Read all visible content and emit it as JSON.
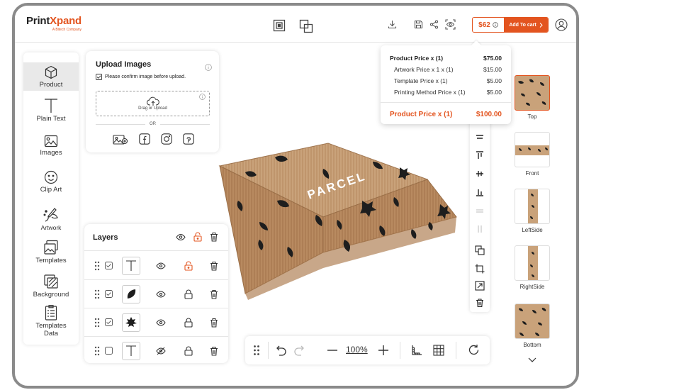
{
  "brand": {
    "name_part1": "Print",
    "name_part2": "Xpand",
    "tagline": "A Bitech Company",
    "accent_color": "#e3541f"
  },
  "header": {
    "icons": [
      "download-icon",
      "save-icon",
      "share-icon",
      "preview-icon",
      "layers-front-icon",
      "layers-back-icon",
      "info-icon",
      "user-icon"
    ],
    "price": "$62",
    "cart_label": "Add To cart"
  },
  "tools": [
    {
      "label": "Product",
      "icon": "cube-icon",
      "active": true
    },
    {
      "label": "Plain Text",
      "icon": "text-icon"
    },
    {
      "label": "Images",
      "icon": "image-icon"
    },
    {
      "label": "Clip Art",
      "icon": "smiley-icon"
    },
    {
      "label": "Artwork",
      "icon": "artwork-icon"
    },
    {
      "label": "Templates",
      "icon": "templates-icon"
    },
    {
      "label": "Background",
      "icon": "background-icon"
    },
    {
      "label": "Templates Data",
      "icon": "templates-data-icon"
    }
  ],
  "upload": {
    "title": "Upload Images",
    "confirm_label": "Please confirm image before upload.",
    "drop_label": "Drag or Upload",
    "or_label": "OR",
    "sources": [
      "gallery-icon",
      "facebook-icon",
      "instagram-icon",
      "pinterest-icon"
    ]
  },
  "layers": {
    "title": "Layers",
    "rows": [
      {
        "type": "text",
        "checked": true,
        "visible": true,
        "locked": true
      },
      {
        "type": "leaf",
        "checked": true,
        "visible": true,
        "locked": false
      },
      {
        "type": "maple-leaf",
        "checked": true,
        "visible": true,
        "locked": false
      },
      {
        "type": "text",
        "checked": false,
        "visible": false,
        "locked": false
      }
    ]
  },
  "box_print_text": "PARCEL",
  "price_breakdown": {
    "rows": [
      {
        "label": "Product Price x (1)",
        "value": "$75.00",
        "style": "bold"
      },
      {
        "label": "Artwork Price x 1 x (1)",
        "value": "$15.00",
        "style": "sub"
      },
      {
        "label": "Template Price x (1)",
        "value": "$5.00",
        "style": "sub"
      },
      {
        "label": "Printing Method Price x (1)",
        "value": "$5.00",
        "style": "sub"
      }
    ],
    "total_label": "Product Price x (1)",
    "total_value": "$100.00"
  },
  "views": [
    {
      "label": "Top",
      "active": true
    },
    {
      "label": "Front"
    },
    {
      "label": "LeftSide"
    },
    {
      "label": "RightSide"
    },
    {
      "label": "Bottom"
    }
  ],
  "bottom_toolbar": {
    "zoom": "100%"
  }
}
